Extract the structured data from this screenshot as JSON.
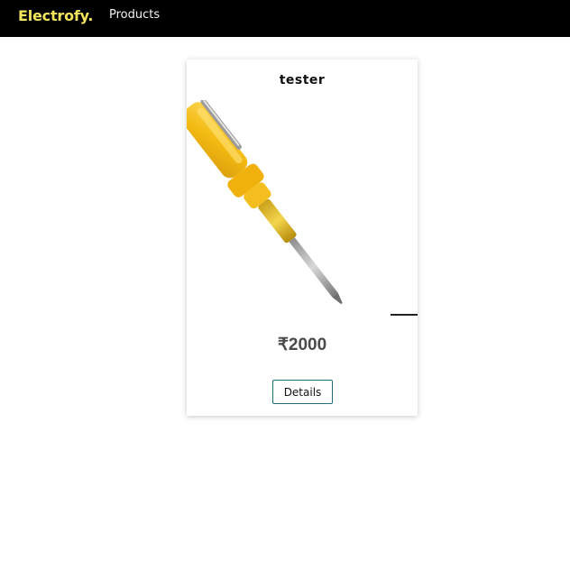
{
  "navbar": {
    "brand": "Electrofy.",
    "links": [
      {
        "label": "Products"
      }
    ]
  },
  "products": [
    {
      "name": "tester",
      "image_icon": "tester-screwdriver-icon",
      "price": "₹2000",
      "button_label": "Details"
    }
  ],
  "colors": {
    "navbar_bg": "#000000",
    "brand": "#f2e55c",
    "nav_link": "#f2f2f2",
    "price": "#4a4a4a",
    "button_border": "#1f6f77",
    "handle_yellow": "#f2b705"
  }
}
